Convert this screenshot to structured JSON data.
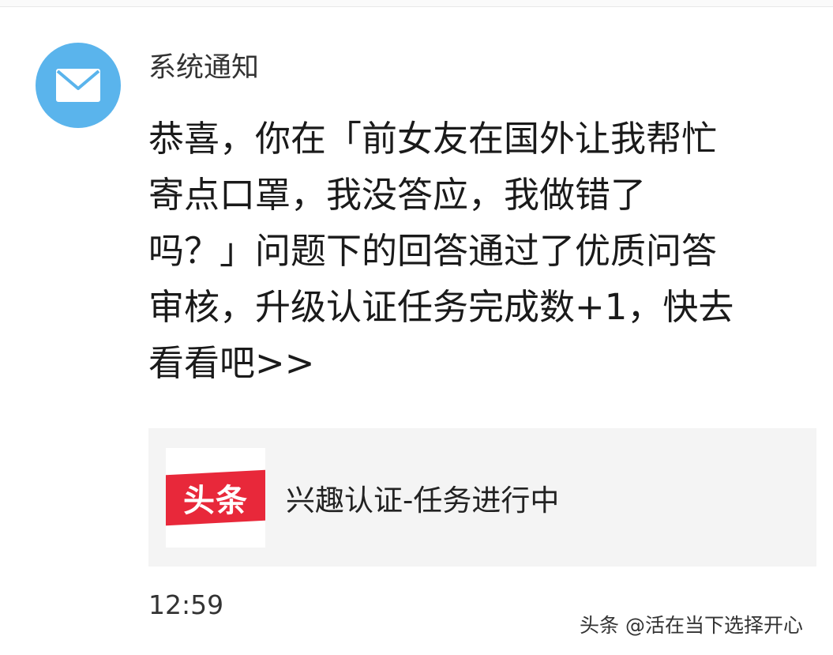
{
  "notification": {
    "sender": "系统通知",
    "avatar_icon": "envelope-icon",
    "avatar_color": "#5ab4ec",
    "message_lines": [
      "恭喜，你在「前女友在国外让我帮忙",
      "寄点口罩，我没答应，我做错了",
      "吗？」问题下的回答通过了优质问答",
      "审核，升级认证任务完成数+1，快去",
      "看看吧>>"
    ],
    "card": {
      "logo_text": "头条",
      "logo_color": "#e8283a",
      "title": "兴趣认证-任务进行中"
    },
    "time": "12:59"
  },
  "watermark": "头条 @活在当下选择开心"
}
